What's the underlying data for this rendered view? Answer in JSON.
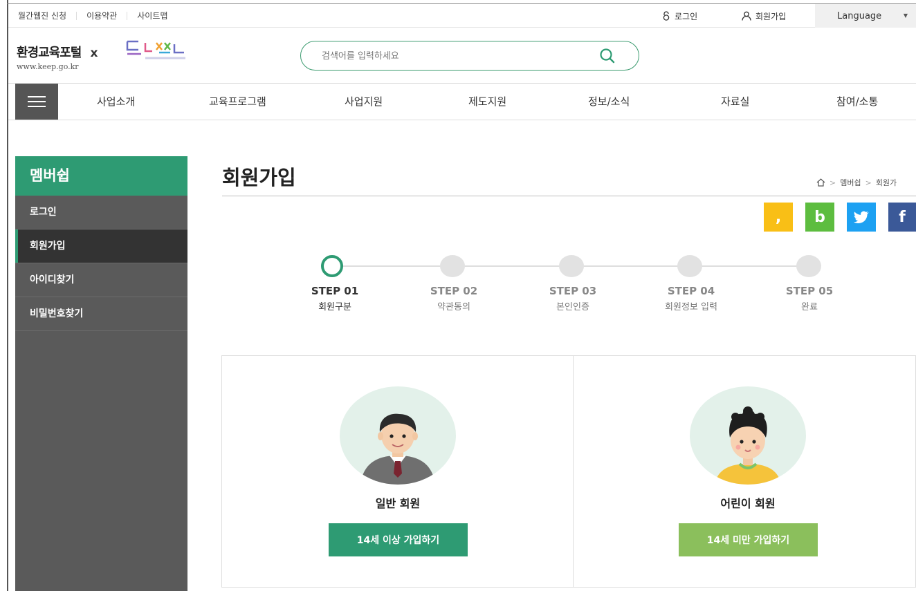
{
  "util": {
    "links": [
      "월간웹진 신청",
      "이용약관",
      "사이트맵"
    ],
    "login": "로그인",
    "join": "회원가입",
    "language": "Language"
  },
  "header": {
    "logo_title": "환경교육포털",
    "logo_x": "x",
    "logo_url": "www.keep.go.kr",
    "search_placeholder": "검색어를 입력하세요"
  },
  "gnb": {
    "items": [
      "사업소개",
      "교육프로그램",
      "사업지원",
      "제도지원",
      "정보/소식",
      "자료실",
      "참여/소통"
    ]
  },
  "lnb": {
    "title": "멤버쉽",
    "items": [
      {
        "label": "로그인"
      },
      {
        "label": "회원가입"
      },
      {
        "label": "아이디찾기"
      },
      {
        "label": "비밀번호찾기"
      }
    ]
  },
  "content": {
    "title": "회원가입",
    "breadcrumb": [
      "멤버쉽",
      "회원가"
    ]
  },
  "share": {
    "kakao": ",",
    "band": "b",
    "facebook": "f"
  },
  "steps": [
    {
      "num": "STEP 01",
      "name": "회원구분"
    },
    {
      "num": "STEP 02",
      "name": "약관동의"
    },
    {
      "num": "STEP 03",
      "name": "본인인증"
    },
    {
      "num": "STEP 04",
      "name": "회원정보 입력"
    },
    {
      "num": "STEP 05",
      "name": "완료"
    }
  ],
  "cards": {
    "adult": {
      "label": "일반 회원",
      "button": "14세 이상 가입하기"
    },
    "child": {
      "label": "어린이 회원",
      "button": "14세 미만 가입하기"
    }
  },
  "colors": {
    "brand_green": "#2e9b73",
    "child_green": "#8bbf5c",
    "sidebar_gray": "#5a5a5a",
    "kakao": "#f9bf16",
    "band": "#5dbd3f",
    "twitter": "#1da1f2",
    "facebook": "#3b5998"
  }
}
